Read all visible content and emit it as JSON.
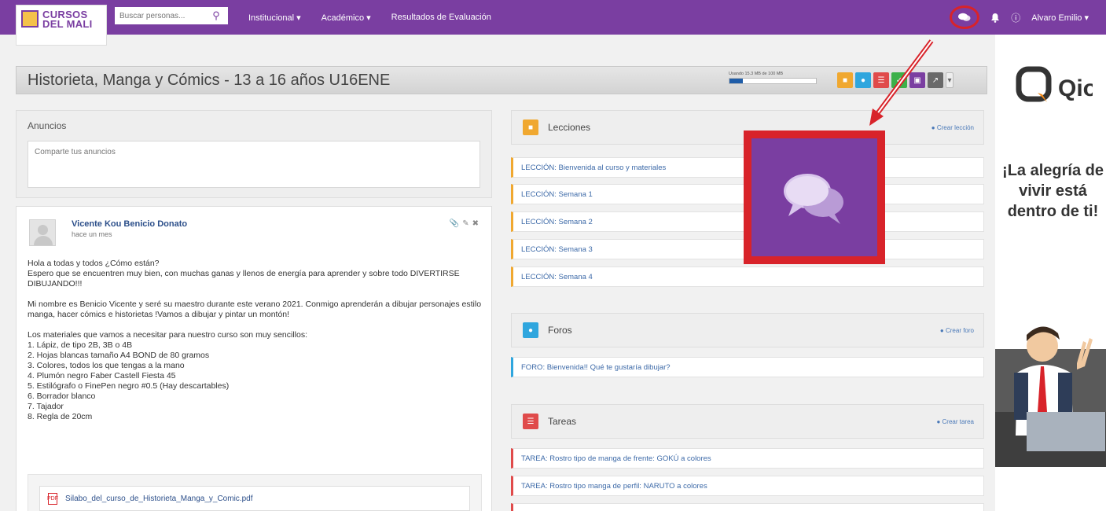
{
  "brand": {
    "line1": "CURSOS",
    "line2": "DEL MALI"
  },
  "search": {
    "placeholder": "Buscar personas..."
  },
  "nav": {
    "items": [
      "Institucional ▾",
      "Académico ▾",
      "Resultados de Evaluación"
    ]
  },
  "user": {
    "name": "Alvaro Emilio ▾"
  },
  "course": {
    "title": "Historieta, Manga y Cómics - 13 a 16 años U16ENE",
    "storage_label": "Usando 15.3 MB de 100 MB",
    "storage_fraction": 0.153,
    "storage_badge": "15%",
    "tool_colors": [
      "#f0a830",
      "#2fa6de",
      "#e04b4b",
      "#3cb04a",
      "#7a3ea1",
      "#6a6a6a"
    ]
  },
  "announcements": {
    "title": "Anuncios",
    "placeholder": "Comparte tus anuncios"
  },
  "post": {
    "author": "Vicente Kou Benicio Donato",
    "time": "hace un mes",
    "greeting": "Hola a todas y todos ¿Cómo están?",
    "p1": "Espero que se encuentren muy bien, con muchas ganas y llenos de energía para aprender y sobre todo DIVERTIRSE DIBUJANDO!!!",
    "p2": "Mi nombre es Benicio Vicente y seré su maestro durante este verano 2021. Conmigo aprenderán a dibujar personajes estilo manga, hacer cómics e historietas !Vamos a dibujar y pintar un montón!",
    "materials_intro": "Los materiales que vamos a necesitar para nuestro curso son muy sencillos:",
    "materials": [
      "1. Lápiz, de tipo 2B, 3B o 4B",
      "2. Hojas blancas tamaño A4 BOND de 80 gramos",
      "3. Colores, todos los que tengas a la mano",
      "4. Plumón negro Faber Castell Fiesta 45",
      "5. Estilógrafo o FinePen negro #0.5 (Hay descartables)",
      "6. Borrador blanco",
      "7. Tajador",
      "8. Regla de 20cm"
    ],
    "attachment": "Silabo_del_curso_de_Historieta_Manga_y_Comic.pdf"
  },
  "lessons": {
    "title": "Lecciones",
    "create": "Crear lección",
    "items": [
      "LECCIÓN: Bienvenida al curso y materiales",
      "LECCIÓN: Semana 1",
      "LECCIÓN: Semana 2",
      "LECCIÓN: Semana 3",
      "LECCIÓN: Semana 4"
    ]
  },
  "forums": {
    "title": "Foros",
    "create": "Crear foro",
    "items": [
      "FORO: Bienvenida!! Qué te gustaría dibujar?"
    ]
  },
  "tasks": {
    "title": "Tareas",
    "create": "Crear tarea",
    "items": [
      "TAREA: Rostro tipo de manga de frente: GOKÚ a colores",
      "TAREA: Rostro tipo manga de perfil: NARUTO a colores"
    ]
  },
  "ad": {
    "brand": "Qio",
    "slogan": "¡La alegría de vivir está dentro de ti!"
  },
  "colors": {
    "purple": "#7a3ea1",
    "highlight": "#d8232a",
    "link": "#3d6aa8"
  }
}
